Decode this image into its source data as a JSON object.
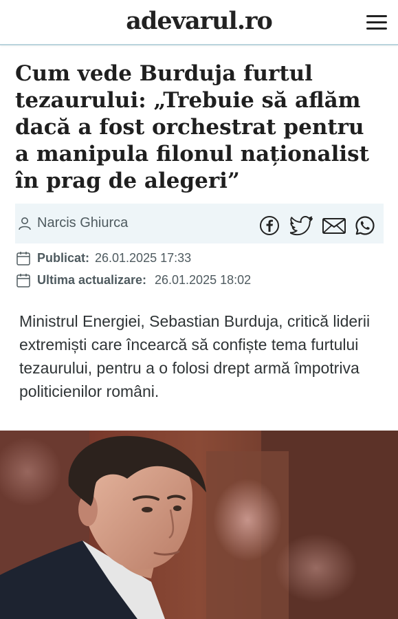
{
  "site": {
    "logo_text": "adevarul.ro",
    "menu_icon": "hamburger-icon"
  },
  "article": {
    "title": "Cum vede Burduja furtul tezaurului: „Trebuie să aflăm dacă a fost orchestrat pentru a manipula filonul naționalist în prag de alegeri”",
    "author": "Narcis Ghiurca",
    "published_label": "Publicat:",
    "published_value": "26.01.2025 17:33",
    "updated_label": "Ultima actualizare:",
    "updated_value": "26.01.2025 18:02",
    "lead": "Ministrul Energiei, Sebastian Burduja, critică liderii extremiști care încearcă să confiște tema furtului tezaurului, pentru a o folosi drept armă împotriva politicienilor români."
  },
  "share_icons": [
    "facebook-icon",
    "twitter-icon",
    "email-icon",
    "whatsapp-icon"
  ],
  "colors": {
    "header_border": "#b9d3dc",
    "author_bar_bg": "#eef5f8",
    "text_dark": "#1f1f1f",
    "meta_text": "#4e5a5f"
  }
}
